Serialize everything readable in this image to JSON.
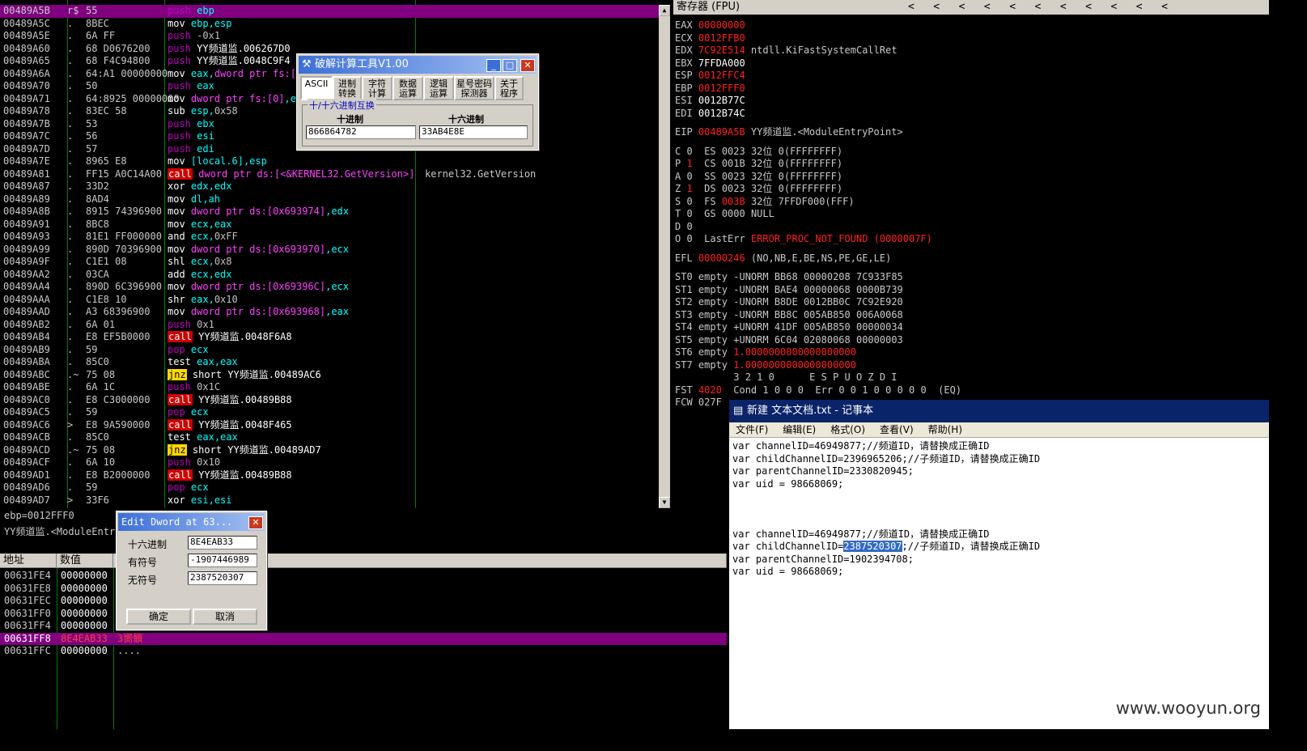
{
  "disasm": {
    "rows": [
      {
        "addr": "00489A5B",
        "mark": "r$",
        "hex": "55",
        "mn": "push",
        "ops": [
          {
            "t": "ebp",
            "c": "reg"
          }
        ],
        "sel": true
      },
      {
        "addr": "00489A5C",
        "mark": ".",
        "hex": "8BEC",
        "mn": "mov",
        "ops": [
          {
            "t": "ebp,esp",
            "c": "reg"
          }
        ]
      },
      {
        "addr": "00489A5E",
        "mark": ".",
        "hex": "6A FF",
        "mn": "push",
        "ops": [
          {
            "t": "-0x1",
            "c": "imm"
          }
        ]
      },
      {
        "addr": "00489A60",
        "mark": ".",
        "hex": "68 D0676200",
        "mn": "push",
        "ops": [
          {
            "t": "YY频道监.006267D0",
            "c": "txt"
          }
        ]
      },
      {
        "addr": "00489A65",
        "mark": ".",
        "hex": "68 F4C94800",
        "mn": "push",
        "ops": [
          {
            "t": "YY频道监.0048C9F4",
            "c": "txt"
          }
        ]
      },
      {
        "addr": "00489A6A",
        "mark": ".",
        "hex": "64:A1 00000000",
        "mn": "mov",
        "ops": [
          {
            "t": "eax,",
            "c": "reg"
          },
          {
            "t": "dword ptr fs:[0]",
            "c": "mem"
          }
        ]
      },
      {
        "addr": "00489A70",
        "mark": ".",
        "hex": "50",
        "mn": "push",
        "ops": [
          {
            "t": "eax",
            "c": "reg"
          }
        ]
      },
      {
        "addr": "00489A71",
        "mark": ".",
        "hex": "64:8925 00000000",
        "mn": "mov",
        "ops": [
          {
            "t": "dword ptr fs:[0]",
            "c": "mem"
          },
          {
            "t": ",esp",
            "c": "reg"
          }
        ]
      },
      {
        "addr": "00489A78",
        "mark": ".",
        "hex": "83EC 58",
        "mn": "sub",
        "ops": [
          {
            "t": "esp,",
            "c": "reg"
          },
          {
            "t": "0x58",
            "c": "imm"
          }
        ]
      },
      {
        "addr": "00489A7B",
        "mark": ".",
        "hex": "53",
        "mn": "push",
        "ops": [
          {
            "t": "ebx",
            "c": "reg"
          }
        ]
      },
      {
        "addr": "00489A7C",
        "mark": ".",
        "hex": "56",
        "mn": "push",
        "ops": [
          {
            "t": "esi",
            "c": "reg"
          }
        ]
      },
      {
        "addr": "00489A7D",
        "mark": ".",
        "hex": "57",
        "mn": "push",
        "ops": [
          {
            "t": "edi",
            "c": "reg"
          }
        ]
      },
      {
        "addr": "00489A7E",
        "mark": ".",
        "hex": "8965 E8",
        "mn": "mov",
        "ops": [
          {
            "t": "[local.6],esp",
            "c": "reg"
          }
        ]
      },
      {
        "addr": "00489A81",
        "mark": ".",
        "hex": "FF15 A0C14A00",
        "mn": "call",
        "ops": [
          {
            "t": "dword ptr ds:[<&KERNEL32.GetVersion>]",
            "c": "mem"
          }
        ],
        "cmt": "kernel32.GetVersion"
      },
      {
        "addr": "00489A87",
        "mark": ".",
        "hex": "33D2",
        "mn": "xor",
        "ops": [
          {
            "t": "edx,edx",
            "c": "reg"
          }
        ]
      },
      {
        "addr": "00489A89",
        "mark": ".",
        "hex": "8AD4",
        "mn": "mov",
        "ops": [
          {
            "t": "dl,ah",
            "c": "reg"
          }
        ]
      },
      {
        "addr": "00489A8B",
        "mark": ".",
        "hex": "8915 74396900",
        "mn": "mov",
        "ops": [
          {
            "t": "dword ptr ds:[0x693974]",
            "c": "mem"
          },
          {
            "t": ",edx",
            "c": "reg"
          }
        ]
      },
      {
        "addr": "00489A91",
        "mark": ".",
        "hex": "8BC8",
        "mn": "mov",
        "ops": [
          {
            "t": "ecx,eax",
            "c": "reg"
          }
        ]
      },
      {
        "addr": "00489A93",
        "mark": ".",
        "hex": "81E1 FF000000",
        "mn": "and",
        "ops": [
          {
            "t": "ecx,",
            "c": "reg"
          },
          {
            "t": "0xFF",
            "c": "imm"
          }
        ]
      },
      {
        "addr": "00489A99",
        "mark": ".",
        "hex": "890D 70396900",
        "mn": "mov",
        "ops": [
          {
            "t": "dword ptr ds:[0x693970]",
            "c": "mem"
          },
          {
            "t": ",ecx",
            "c": "reg"
          }
        ]
      },
      {
        "addr": "00489A9F",
        "mark": ".",
        "hex": "C1E1 08",
        "mn": "shl",
        "ops": [
          {
            "t": "ecx,",
            "c": "reg"
          },
          {
            "t": "0x8",
            "c": "imm"
          }
        ]
      },
      {
        "addr": "00489AA2",
        "mark": ".",
        "hex": "03CA",
        "mn": "add",
        "ops": [
          {
            "t": "ecx,edx",
            "c": "reg"
          }
        ]
      },
      {
        "addr": "00489AA4",
        "mark": ".",
        "hex": "890D 6C396900",
        "mn": "mov",
        "ops": [
          {
            "t": "dword ptr ds:[0x69396C]",
            "c": "mem"
          },
          {
            "t": ",ecx",
            "c": "reg"
          }
        ]
      },
      {
        "addr": "00489AAA",
        "mark": ".",
        "hex": "C1E8 10",
        "mn": "shr",
        "ops": [
          {
            "t": "eax,",
            "c": "reg"
          },
          {
            "t": "0x10",
            "c": "imm"
          }
        ]
      },
      {
        "addr": "00489AAD",
        "mark": ".",
        "hex": "A3 68396900",
        "mn": "mov",
        "ops": [
          {
            "t": "dword ptr ds:[0x693968]",
            "c": "mem"
          },
          {
            "t": ",eax",
            "c": "reg"
          }
        ]
      },
      {
        "addr": "00489AB2",
        "mark": ".",
        "hex": "6A 01",
        "mn": "push",
        "ops": [
          {
            "t": "0x1",
            "c": "imm"
          }
        ]
      },
      {
        "addr": "00489AB4",
        "mark": ".",
        "hex": "E8 EF5B0000",
        "mn": "call",
        "ops": [
          {
            "t": "YY频道监.0048F6A8",
            "c": "txt"
          }
        ]
      },
      {
        "addr": "00489AB9",
        "mark": ".",
        "hex": "59",
        "mn": "pop",
        "ops": [
          {
            "t": "ecx",
            "c": "reg"
          }
        ]
      },
      {
        "addr": "00489ABA",
        "mark": ".",
        "hex": "85C0",
        "mn": "test",
        "ops": [
          {
            "t": "eax,eax",
            "c": "reg"
          }
        ]
      },
      {
        "addr": "00489ABC",
        "mark": ".~",
        "hex": "75 08",
        "mn": "jnz",
        "ops": [
          {
            "t": "short YY频道监.00489AC6",
            "c": "txt"
          }
        ]
      },
      {
        "addr": "00489ABE",
        "mark": ".",
        "hex": "6A 1C",
        "mn": "push",
        "ops": [
          {
            "t": "0x1C",
            "c": "imm"
          }
        ]
      },
      {
        "addr": "00489AC0",
        "mark": ".",
        "hex": "E8 C3000000",
        "mn": "call",
        "ops": [
          {
            "t": "YY频道监.00489B88",
            "c": "txt"
          }
        ]
      },
      {
        "addr": "00489AC5",
        "mark": ".",
        "hex": "59",
        "mn": "pop",
        "ops": [
          {
            "t": "ecx",
            "c": "reg"
          }
        ]
      },
      {
        "addr": "00489AC6",
        "mark": ">",
        "hex": "E8 9A590000",
        "mn": "call",
        "ops": [
          {
            "t": "YY频道监.0048F465",
            "c": "txt"
          }
        ]
      },
      {
        "addr": "00489ACB",
        "mark": ".",
        "hex": "85C0",
        "mn": "test",
        "ops": [
          {
            "t": "eax,eax",
            "c": "reg"
          }
        ]
      },
      {
        "addr": "00489ACD",
        "mark": ".~",
        "hex": "75 08",
        "mn": "jnz",
        "ops": [
          {
            "t": "short YY频道监.00489AD7",
            "c": "txt"
          }
        ]
      },
      {
        "addr": "00489ACF",
        "mark": ".",
        "hex": "6A 10",
        "mn": "push",
        "ops": [
          {
            "t": "0x10",
            "c": "imm"
          }
        ]
      },
      {
        "addr": "00489AD1",
        "mark": ".",
        "hex": "E8 B2000000",
        "mn": "call",
        "ops": [
          {
            "t": "YY频道监.00489B88",
            "c": "txt"
          }
        ]
      },
      {
        "addr": "00489AD6",
        "mark": ".",
        "hex": "59",
        "mn": "pop",
        "ops": [
          {
            "t": "ecx",
            "c": "reg"
          }
        ]
      },
      {
        "addr": "00489AD7",
        "mark": ">",
        "hex": "33F6",
        "mn": "xor",
        "ops": [
          {
            "t": "esi,esi",
            "c": "reg"
          }
        ]
      }
    ]
  },
  "info": {
    "line1": "ebp=0012FFF0",
    "line2": "YY频道监.<ModuleEntryPoint>"
  },
  "registers": {
    "header": "寄存器 (FPU)",
    "header_arrows": "<   <   <   <   <   <   <   <   <   <   <",
    "gp": [
      {
        "name": "EAX",
        "val": "00000000",
        "red": true,
        "note": ""
      },
      {
        "name": "ECX",
        "val": "0012FFB0",
        "red": true,
        "note": ""
      },
      {
        "name": "EDX",
        "val": "7C92E514",
        "red": true,
        "note": "ntdll.KiFastSystemCallRet"
      },
      {
        "name": "EBX",
        "val": "7FFDA000",
        "red": false,
        "note": ""
      },
      {
        "name": "ESP",
        "val": "0012FFC4",
        "red": true,
        "note": ""
      },
      {
        "name": "EBP",
        "val": "0012FFF0",
        "red": true,
        "note": ""
      },
      {
        "name": "ESI",
        "val": "0012B77C",
        "red": false,
        "note": ""
      },
      {
        "name": "EDI",
        "val": "0012B74C",
        "red": false,
        "note": ""
      }
    ],
    "eip": {
      "name": "EIP",
      "val": "00489A5B",
      "note": "YY频道监.<ModuleEntryPoint>"
    },
    "flags": [
      {
        "f": "C",
        "v": "0",
        "vred": false,
        "seg": "ES 0023 32位 0(FFFFFFFF)",
        "segred": false
      },
      {
        "f": "P",
        "v": "1",
        "vred": true,
        "seg": "CS 001B 32位 0(FFFFFFFF)",
        "segred": false
      },
      {
        "f": "A",
        "v": "0",
        "vred": false,
        "seg": "SS 0023 32位 0(FFFFFFFF)",
        "segred": false
      },
      {
        "f": "Z",
        "v": "1",
        "vred": true,
        "seg": "DS 0023 32位 0(FFFFFFFF)",
        "segred": false
      },
      {
        "f": "S",
        "v": "0",
        "vred": false,
        "seg": "FS 003B 32位 7FFDF000(FFF)",
        "segred": true
      },
      {
        "f": "T",
        "v": "0",
        "vred": false,
        "seg": "GS 0000 NULL",
        "segred": false
      },
      {
        "f": "D",
        "v": "0",
        "vred": false,
        "seg": "",
        "segred": false
      }
    ],
    "lasterr": {
      "f": "O",
      "v": "0",
      "label": "LastErr",
      "val": "ERROR_PROC_NOT_FOUND (0000007F)"
    },
    "efl": {
      "label": "EFL",
      "val": "00000246",
      "note": "(NO,NB,E,BE,NS,PE,GE,LE)"
    },
    "fpu": [
      {
        "name": "ST0",
        "state": "empty",
        "val": "-UNORM BB68 00000208 7C933F85",
        "red": false
      },
      {
        "name": "ST1",
        "state": "empty",
        "val": "-UNORM BAE4 00000068 0000B739",
        "red": false
      },
      {
        "name": "ST2",
        "state": "empty",
        "val": "-UNORM B8DE 0012BB0C 7C92E920",
        "red": false
      },
      {
        "name": "ST3",
        "state": "empty",
        "val": "-UNORM BB8C 005AB850 006A0068",
        "red": false
      },
      {
        "name": "ST4",
        "state": "empty",
        "val": "+UNORM 41DF 005AB850 00000034",
        "red": false
      },
      {
        "name": "ST5",
        "state": "empty",
        "val": "+UNORM 6C04 02080068 00000003",
        "red": false
      },
      {
        "name": "ST6",
        "state": "empty",
        "val": "1.0000000000000000000",
        "red": true
      },
      {
        "name": "ST7",
        "state": "empty",
        "val": "1.0000000000000000000",
        "red": true
      }
    ],
    "fpu_hdr": "3 2 1 0      E S P U O Z D I",
    "fst": {
      "label": "FST",
      "val": "4020",
      "cond_label": "Cond",
      "cond": "1 0 0 0",
      "err_label": "Err",
      "err": "0 0 1 0 0 0 0 0",
      "tail": "(EQ)"
    },
    "fcw": {
      "label": "FCW",
      "val": "027F"
    }
  },
  "dump": {
    "col_addr": "地址",
    "col_val": "数值",
    "rows": [
      {
        "addr": "00631FE4",
        "val": "00000000",
        "note": "",
        "sel": false
      },
      {
        "addr": "00631FE8",
        "val": "00000000",
        "note": "",
        "sel": false
      },
      {
        "addr": "00631FEC",
        "val": "00000000",
        "note": "",
        "sel": false
      },
      {
        "addr": "00631FF0",
        "val": "00000000",
        "note": "",
        "sel": false
      },
      {
        "addr": "00631FF4",
        "val": "00000000",
        "note": "",
        "sel": false
      },
      {
        "addr": "00631FF8",
        "val": "8E4EAB33",
        "note": "3嚮顝",
        "sel": true
      },
      {
        "addr": "00631FFC",
        "val": "00000000",
        "note": "....",
        "sel": false
      }
    ]
  },
  "calc": {
    "title": "破解计算工具V1.00",
    "tabs": [
      "ASCII",
      "进制\n转换",
      "字符\n计算",
      "数据\n运算",
      "逻辑\n运算",
      "星号密码\n探测器",
      "关于\n程序"
    ],
    "group": "十/十六进制互换",
    "dec_label": "十进制",
    "hex_label": "十六进制",
    "dec_value": "866864782",
    "hex_value": "33AB4E8E"
  },
  "edit_dword": {
    "title": "Edit Dword at 63...",
    "hex_label": "十六进制",
    "hex_value": "8E4EAB33",
    "signed_label": "有符号",
    "signed_value": "-1907446989",
    "unsigned_label": "无符号",
    "unsigned_value": "2387520307",
    "ok": "确定",
    "cancel": "取消"
  },
  "notepad": {
    "title": "新建 文本文档.txt - 记事本",
    "menu": [
      "文件(F)",
      "编辑(E)",
      "格式(O)",
      "查看(V)",
      "帮助(H)"
    ],
    "lines": [
      "var channelID=46949877;//频道ID，请替换成正确ID",
      "var childChannelID=2396965206;//子频道ID，请替换成正确ID",
      "var parentChannelID=2330820945;",
      "var uid = 98668069;",
      "",
      "",
      "",
      "var channelID=46949877;//频道ID，请替换成正确ID"
    ],
    "hl_line": {
      "pre": "var childChannelID=",
      "hl": "2387520307",
      "post": ";//子频道ID，请替换成正确ID"
    },
    "lines2": [
      "var parentChannelID=1902394708;",
      "var uid = 98668069;"
    ]
  },
  "watermark": "www.wooyun.org"
}
